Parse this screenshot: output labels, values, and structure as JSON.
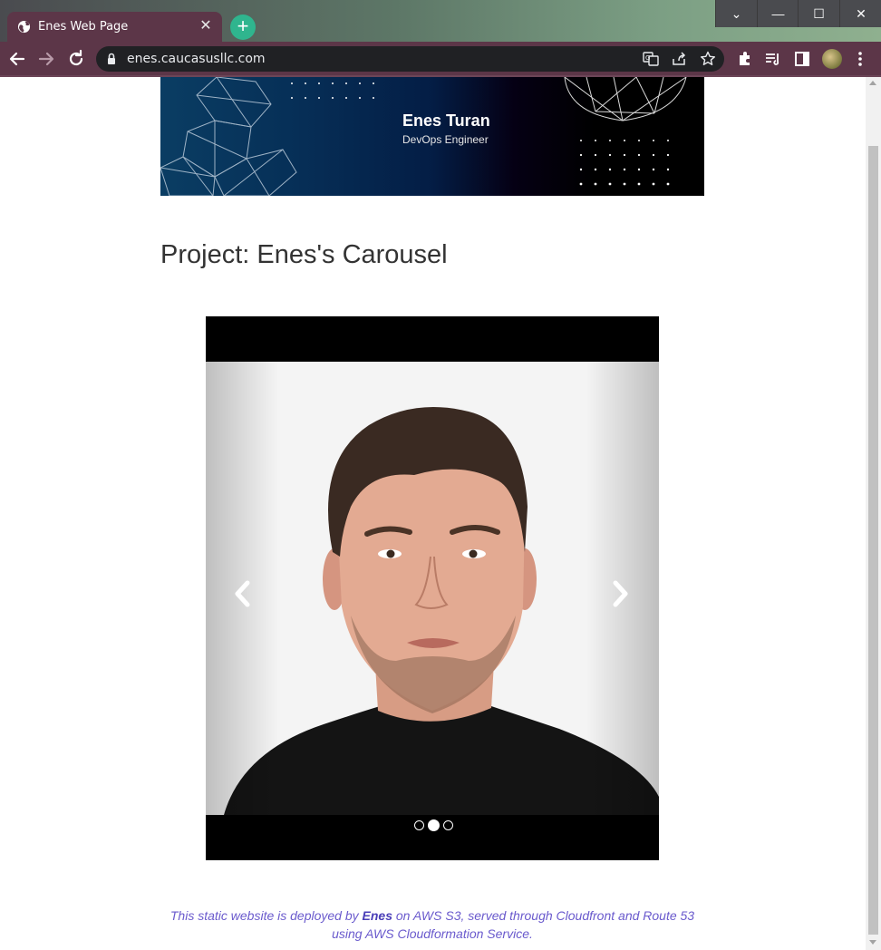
{
  "browser": {
    "tab_title": "Enes Web Page",
    "url": "enes.caucasusllc.com"
  },
  "banner": {
    "name": "Enes Turan",
    "role": "DevOps Engineer"
  },
  "page": {
    "title": "Project: Enes's Carousel"
  },
  "carousel": {
    "slides": 3,
    "active_index": 1
  },
  "footer": {
    "line_start": "This static website is deployed by ",
    "author": "Enes",
    "line_end": " on AWS S3, served through Cloudfront and Route 53 using AWS Cloudformation Service."
  },
  "colors": {
    "toolbar": "#5c3648",
    "footer_text": "#6a5acd",
    "newtab_button": "#2fb58e"
  }
}
